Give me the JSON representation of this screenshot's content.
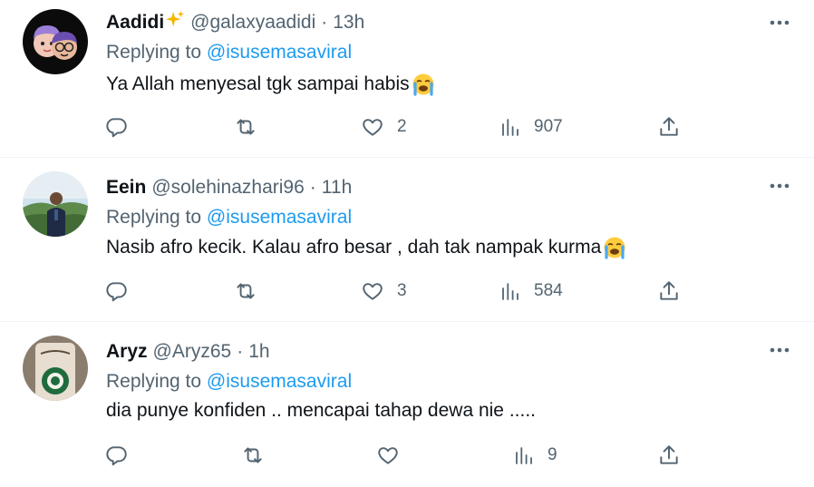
{
  "tweets": [
    {
      "name": "Aadidi",
      "handle": "@galaxyaadidi",
      "time": "13h",
      "replying_prefix": "Replying to",
      "replying_to": "@isusemasaviral",
      "text": "Ya Allah menyesal tgk sampai habis",
      "emoji": "crying-face-emoji",
      "likes": "2",
      "views": "907"
    },
    {
      "name": "Eein",
      "handle": "@solehinazhari96",
      "time": "11h",
      "replying_prefix": "Replying to",
      "replying_to": "@isusemasaviral",
      "text": "Nasib afro kecik. Kalau afro besar , dah tak nampak kurma",
      "emoji": "crying-face-emoji",
      "likes": "3",
      "views": "584"
    },
    {
      "name": "Aryz",
      "handle": "@Aryz65",
      "time": "1h",
      "replying_prefix": "Replying to",
      "replying_to": "@isusemasaviral",
      "text": "dia punye konfiden .. mencapai tahap dewa nie .....",
      "likes": "",
      "views": "9"
    }
  ],
  "separator": "·",
  "colors": {
    "text": "#0f1419",
    "secondary": "#536471",
    "link": "#1d9bf0",
    "divider": "#eff3f4"
  }
}
